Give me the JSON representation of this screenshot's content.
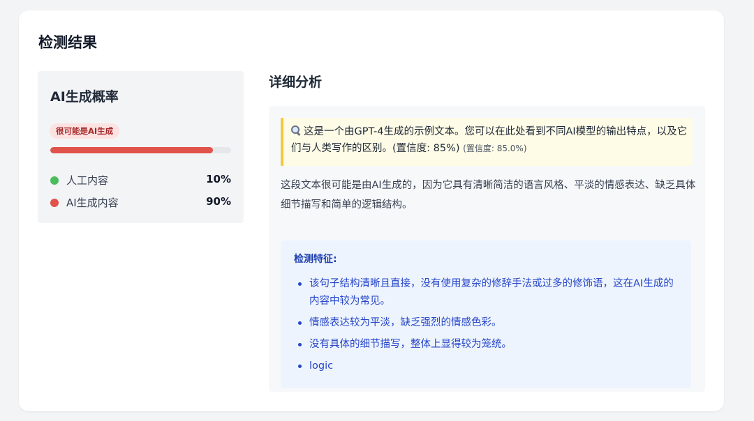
{
  "page": {
    "title": "检测结果"
  },
  "probability": {
    "title": "AI生成概率",
    "verdict": "很可能是AI生成",
    "ai_fraction": 0.9,
    "bar_color": "#e0524a",
    "items": [
      {
        "label": "人工内容",
        "value": "10%",
        "color": "#4cbb5c"
      },
      {
        "label": "AI生成内容",
        "value": "90%",
        "color": "#e0524a"
      }
    ]
  },
  "detail": {
    "title": "详细分析",
    "highlight": {
      "icon": "search-icon",
      "text": "这是一个由GPT-4生成的示例文本。您可以在此处看到不同AI模型的输出特点，以及它们与人类写作的区别。(置信度: 85%)",
      "confidence_note": "(置信度: 85.0%)"
    },
    "explanation": "这段文本很可能是由AI生成的，因为它具有清晰简洁的语言风格、平淡的情感表达、缺乏具体细节描写和简单的逻辑结构。",
    "features": {
      "title": "检测特征:",
      "items": [
        "该句子结构清晰且直接，没有使用复杂的修辞手法或过多的修饰语，这在AI生成的内容中较为常见。",
        "情感表达较为平淡，缺乏强烈的情感色彩。",
        "没有具体的细节描写，整体上显得较为笼统。",
        "logic"
      ]
    }
  }
}
